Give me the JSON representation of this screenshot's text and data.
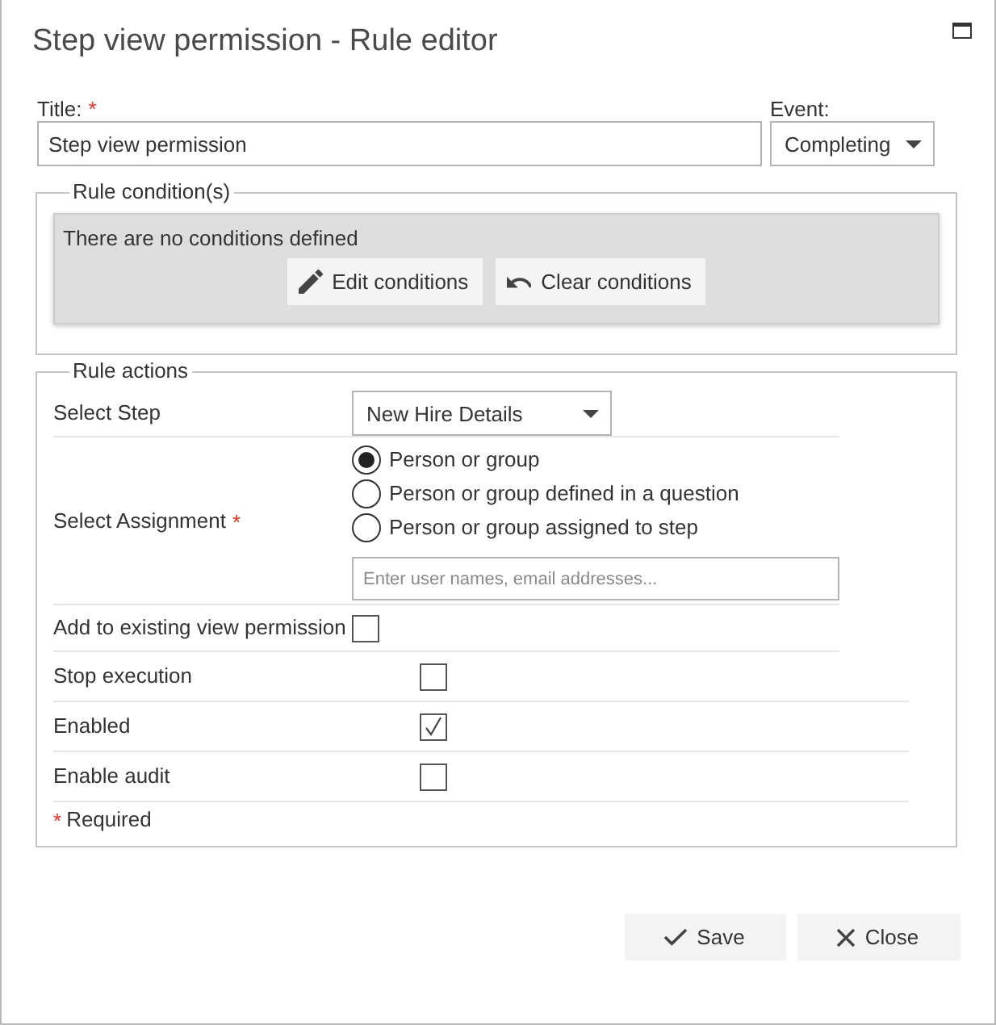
{
  "window": {
    "title": "Step view permission - Rule editor"
  },
  "header_fields": {
    "title": {
      "label": "Title:",
      "required_mark": "*",
      "value": "Step view permission"
    },
    "event": {
      "label": "Event:",
      "value": "Completing"
    }
  },
  "rule_conditions": {
    "legend": "Rule condition(s)",
    "message": "There are no conditions defined",
    "buttons": [
      {
        "kind": "edit",
        "label": "Edit conditions"
      },
      {
        "kind": "clear",
        "label": "Clear conditions"
      }
    ]
  },
  "rule_actions": {
    "legend": "Rule actions",
    "rows": [
      {
        "kind": "select",
        "label": "Select Step",
        "value": "New Hire Details"
      },
      {
        "kind": "assignment",
        "label": "Select Assignment",
        "required_mark": "*",
        "options": [
          {
            "label": "Person or group",
            "selected": true
          },
          {
            "label": "Person or group defined in a question",
            "selected": false
          },
          {
            "label": "Person or group assigned to step",
            "selected": false
          }
        ],
        "placeholder": "Enter user names, email addresses..."
      },
      {
        "kind": "checkbox",
        "label": "Add to existing view permission",
        "checked": false
      }
    ],
    "flags": [
      {
        "label": "Stop execution",
        "checked": false
      },
      {
        "label": "Enabled",
        "checked": true
      },
      {
        "label": "Enable audit",
        "checked": false
      }
    ],
    "required_note": {
      "mark": "*",
      "text": "Required"
    }
  },
  "footer": {
    "buttons": [
      {
        "kind": "save",
        "label": "Save"
      },
      {
        "kind": "close",
        "label": "Close"
      }
    ]
  }
}
